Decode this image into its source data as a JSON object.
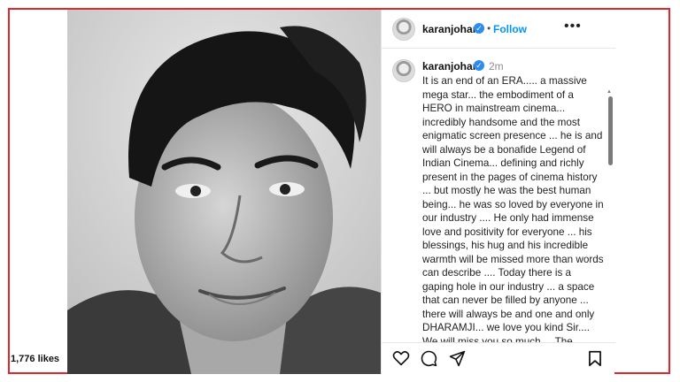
{
  "post": {
    "username": "karanjohar",
    "follow_label": "Follow",
    "separator": "•",
    "time_ago": "2m",
    "caption": "It is an end of an ERA..... a massive mega star... the embodiment of a HERO in mainstream cinema... incredibly handsome and the most  enigmatic screen presence ... he is and will always be a bonafide Legend of Indian Cinema... defining and richly present in the pages of cinema history ... but mostly he was the best human being... he was so loved by everyone in our industry .... He only had immense love and positivity for everyone ... his blessings, his hug and his incredible warmth will be missed more than words can describe .... Today there is a gaping hole in our industry ... a space that can never be filled by anyone ... there will always be and one and only DHARAMJI... we love you kind Sir.... We will miss you so much.... The heavens are blessed today.... It will always be my",
    "likes": "1,776 likes"
  },
  "icons": {
    "verified": "verified-badge-icon",
    "more": "more-options-icon",
    "like": "heart-icon",
    "comment": "comment-icon",
    "share": "share-icon",
    "save": "bookmark-icon"
  },
  "colors": {
    "frame_border": "#e3262c",
    "link_blue": "#0095f6",
    "verified_blue": "#2d8cf0"
  }
}
